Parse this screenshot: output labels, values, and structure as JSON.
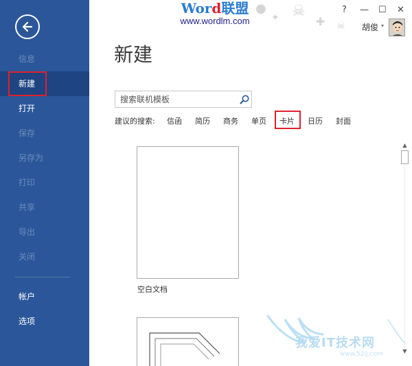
{
  "sidebar": {
    "items": [
      {
        "label": "信息"
      },
      {
        "label": "新建"
      },
      {
        "label": "打开"
      },
      {
        "label": "保存"
      },
      {
        "label": "另存为"
      },
      {
        "label": "打印"
      },
      {
        "label": "共享"
      },
      {
        "label": "导出"
      },
      {
        "label": "关闭"
      },
      {
        "label": "帐户"
      },
      {
        "label": "选项"
      }
    ],
    "colors": {
      "background": "#2b579a",
      "active": "#1e4582",
      "disabled_text": "#6d8bbb"
    }
  },
  "watermark": {
    "title_blue": "Wor",
    "title_red": "d",
    "title_tail": "联盟",
    "url": "www.wordlm.com"
  },
  "window": {
    "help": "?",
    "minimize": "—",
    "maximize": "☐",
    "close": "✕"
  },
  "user": {
    "name": "胡俊",
    "caret": "▾"
  },
  "page": {
    "title": "新建"
  },
  "search": {
    "placeholder": "搜索联机模板"
  },
  "suggestions": {
    "label": "建议的搜索:",
    "links": [
      "信函",
      "简历",
      "商务",
      "单页",
      "卡片",
      "日历",
      "封面"
    ]
  },
  "templates": [
    {
      "name": "空白文档"
    }
  ],
  "site_watermark": {
    "text": "我爱IT技术网",
    "url": "www.52ij.com"
  },
  "highlight_color": "#e0202a"
}
